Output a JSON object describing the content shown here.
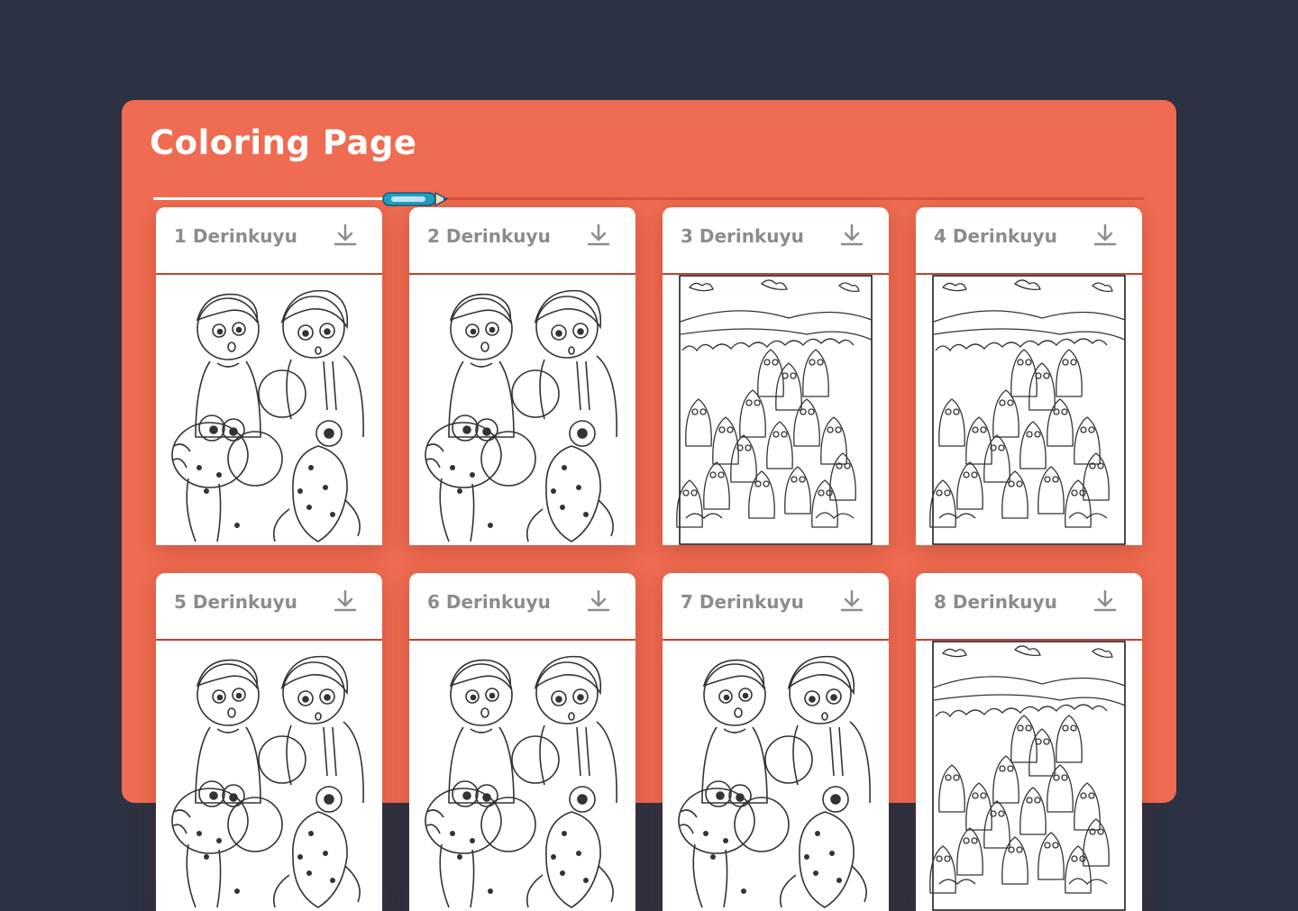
{
  "page": {
    "title": "Coloring Page"
  },
  "colors": {
    "background": "#2d3243",
    "panel": "#ef6b51",
    "accent_pencil": "#1fa0c4"
  },
  "gallery": {
    "items": [
      {
        "label": "1 Derinkuyu",
        "scene": "kids-with-creatures"
      },
      {
        "label": "2 Derinkuyu",
        "scene": "kids-with-creatures"
      },
      {
        "label": "3 Derinkuyu",
        "scene": "crowd-landscape"
      },
      {
        "label": "4 Derinkuyu",
        "scene": "crowd-landscape"
      },
      {
        "label": "5 Derinkuyu",
        "scene": "kids-with-creatures"
      },
      {
        "label": "6 Derinkuyu",
        "scene": "kids-with-creatures"
      },
      {
        "label": "7 Derinkuyu",
        "scene": "kids-with-creatures"
      },
      {
        "label": "8 Derinkuyu",
        "scene": "crowd-landscape"
      }
    ],
    "download_icon": "download-icon"
  }
}
